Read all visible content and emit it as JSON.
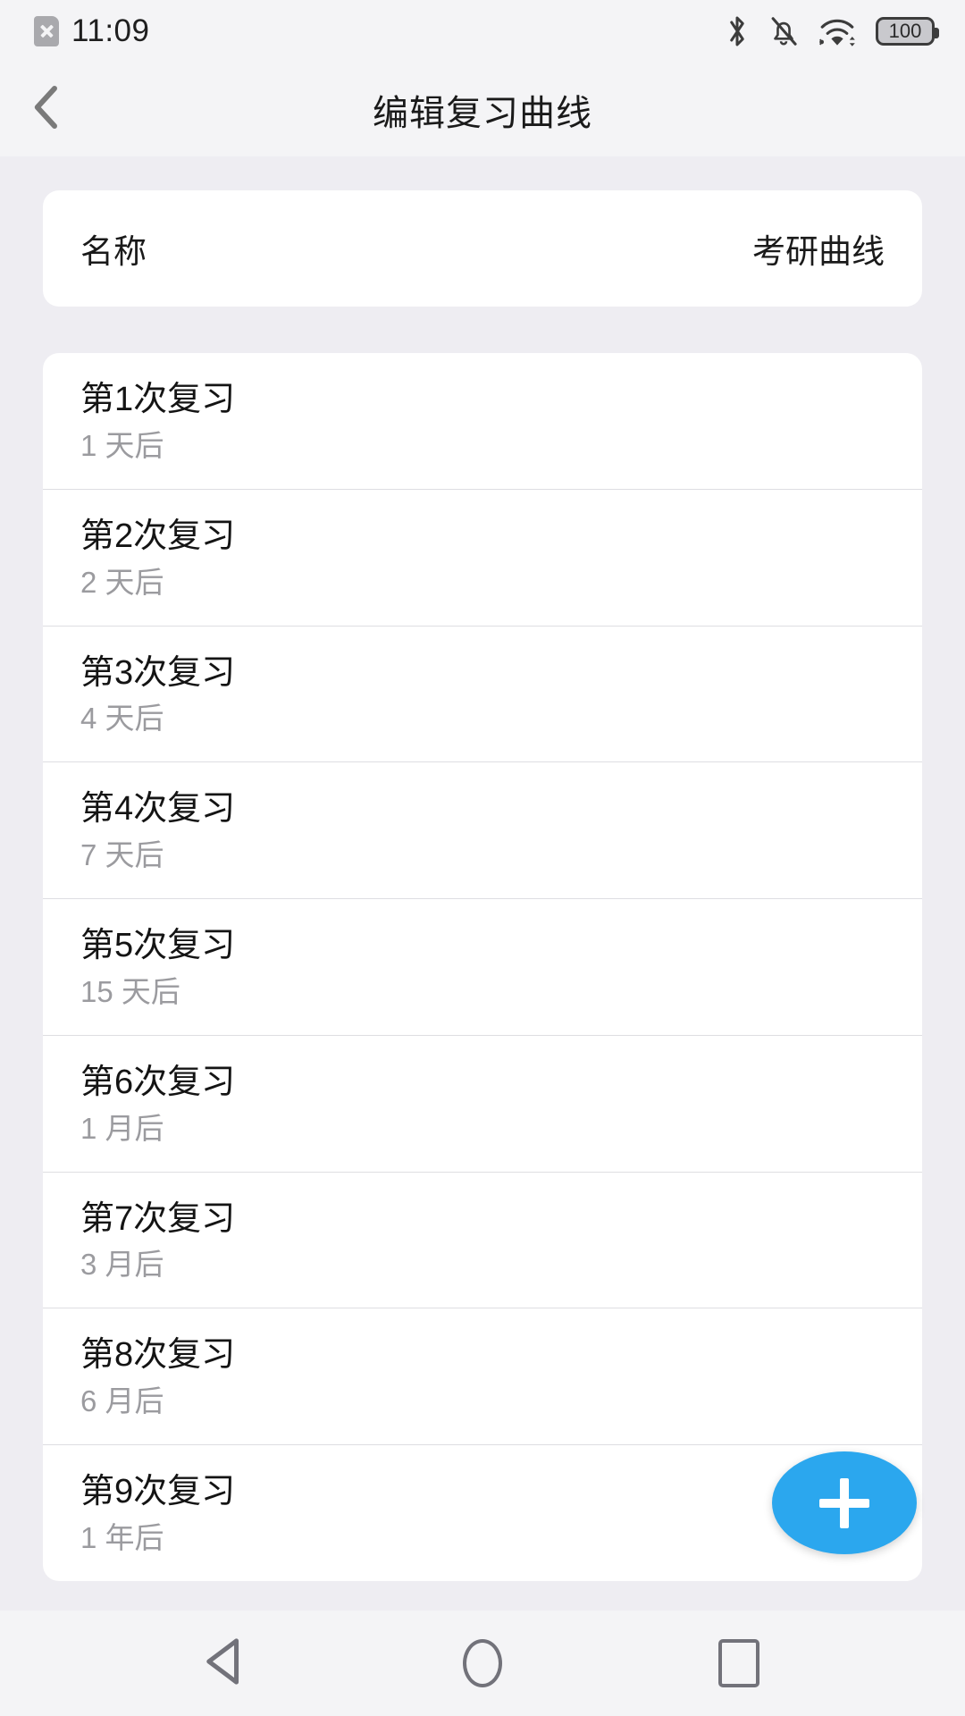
{
  "status_bar": {
    "sim_icon": "sim-off-icon",
    "time": "11:09",
    "bluetooth_icon": "bluetooth-icon",
    "ringer_icon": "bell-muted-icon",
    "wifi_icon": "wifi-icon",
    "battery_level": "100"
  },
  "app_bar": {
    "back_icon": "chevron-left-icon",
    "title": "编辑复习曲线"
  },
  "name_card": {
    "label": "名称",
    "value": "考研曲线"
  },
  "review_list": [
    {
      "title": "第1次复习",
      "subtitle": "1 天后"
    },
    {
      "title": "第2次复习",
      "subtitle": "2 天后"
    },
    {
      "title": "第3次复习",
      "subtitle": "4 天后"
    },
    {
      "title": "第4次复习",
      "subtitle": "7 天后"
    },
    {
      "title": "第5次复习",
      "subtitle": "15 天后"
    },
    {
      "title": "第6次复习",
      "subtitle": "1 月后"
    },
    {
      "title": "第7次复习",
      "subtitle": "3 月后"
    },
    {
      "title": "第8次复习",
      "subtitle": "6 月后"
    },
    {
      "title": "第9次复习",
      "subtitle": "1 年后"
    }
  ],
  "fab": {
    "icon": "plus-icon",
    "color": "#2ba7ee"
  },
  "nav_bar": {
    "back_icon": "triangle-back-icon",
    "home_icon": "circle-home-icon",
    "recents_icon": "square-recents-icon"
  },
  "colors": {
    "page_background": "#eeedf2",
    "bar_background": "#f4f4f6",
    "card_background": "#ffffff",
    "primary_text": "#141414",
    "secondary_text": "#9b9b9f",
    "divider": "#dedee2",
    "accent": "#2ba7ee"
  }
}
